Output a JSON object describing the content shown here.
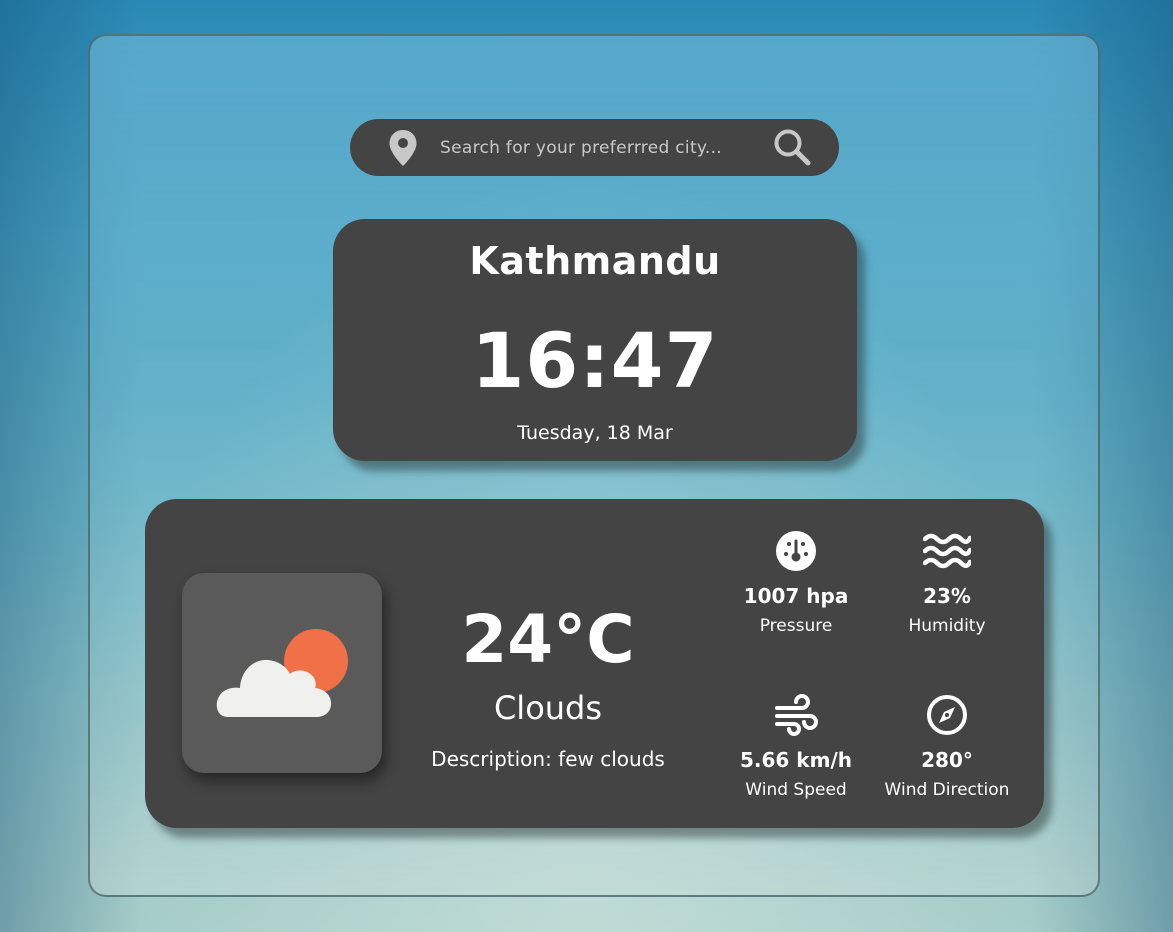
{
  "search": {
    "placeholder": "Search for your preferrred city...",
    "value": "",
    "location_icon": "location-pin-icon",
    "search_icon": "search-icon"
  },
  "clock_card": {
    "city": "Kathmandu",
    "time": "16:47",
    "date": "Tuesday, 18 Mar"
  },
  "weather": {
    "icon": "cloud-sun-icon",
    "temperature": "24°C",
    "condition": "Clouds",
    "description": "Description: few clouds",
    "stats": [
      {
        "icon": "pressure-gauge-icon",
        "value": "1007 hpa",
        "label": "Pressure"
      },
      {
        "icon": "humidity-waves-icon",
        "value": "23%",
        "label": "Humidity"
      },
      {
        "icon": "wind-icon",
        "value": "5.66 km/h",
        "label": "Wind Speed"
      },
      {
        "icon": "compass-icon",
        "value": "280°",
        "label": "Wind Direction"
      }
    ]
  },
  "colors": {
    "card": "#444444",
    "icon_box": "#5a5a5a",
    "sun": "#f07048",
    "cloud": "#f0f0ee",
    "text": "#ffffff"
  }
}
